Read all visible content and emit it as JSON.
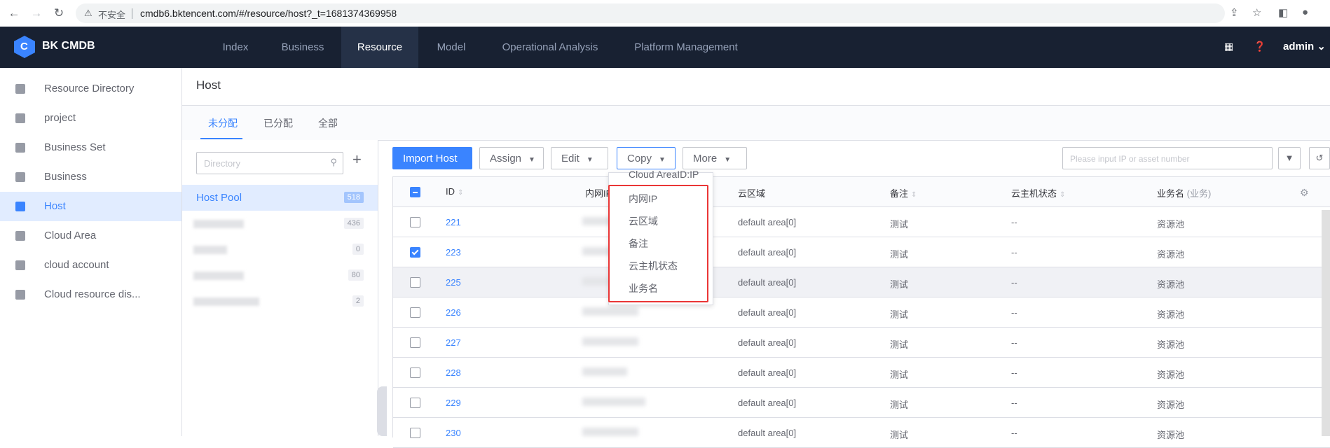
{
  "browser": {
    "insecure_label": "不安全",
    "url": "cmdb6.bktencent.com/#/resource/host?_t=1681374369958"
  },
  "app": {
    "logo_letter": "C",
    "name": "BK CMDB"
  },
  "topnav": {
    "items": [
      "Index",
      "Business",
      "Resource",
      "Model",
      "Operational Analysis",
      "Platform Management"
    ],
    "active": "Resource",
    "user": "admin"
  },
  "sidebar": {
    "items": [
      {
        "label": "Resource Directory"
      },
      {
        "label": "project"
      },
      {
        "label": "Business Set"
      },
      {
        "label": "Business"
      },
      {
        "label": "Host"
      },
      {
        "label": "Cloud Area"
      },
      {
        "label": "cloud account"
      },
      {
        "label": "Cloud resource dis..."
      }
    ],
    "active": "Host"
  },
  "page": {
    "title": "Host"
  },
  "tabs": [
    "未分配",
    "已分配",
    "全部"
  ],
  "directory": {
    "placeholder": "Directory",
    "rows": [
      {
        "name": "Host Pool",
        "count": "518"
      },
      {
        "name": "",
        "count": "436"
      },
      {
        "name": "",
        "count": "0"
      },
      {
        "name": "",
        "count": "80"
      },
      {
        "name": "",
        "count": "2"
      }
    ]
  },
  "toolbar": {
    "import": "Import Host",
    "assign": "Assign",
    "edit": "Edit",
    "copy": "Copy",
    "more": "More",
    "search_placeholder": "Please input IP or asset number"
  },
  "table": {
    "headers": {
      "id": "ID",
      "inner_ip": "内网IP",
      "cloud_area": "云区域",
      "remark": "备注",
      "cloud_status": "云主机状态",
      "biz_name": "业务名",
      "biz_name_sub": "(业务)"
    },
    "rows": [
      {
        "id": "221",
        "cloud_area": "default area[0]",
        "remark": "测试",
        "status": "--",
        "biz": "资源池",
        "checked": false
      },
      {
        "id": "223",
        "cloud_area": "default area[0]",
        "remark": "测试",
        "status": "--",
        "biz": "资源池",
        "checked": true
      },
      {
        "id": "225",
        "cloud_area": "default area[0]",
        "remark": "测试",
        "status": "--",
        "biz": "资源池",
        "checked": false
      },
      {
        "id": "226",
        "cloud_area": "default area[0]",
        "remark": "测试",
        "status": "--",
        "biz": "资源池",
        "checked": false
      },
      {
        "id": "227",
        "cloud_area": "default area[0]",
        "remark": "测试",
        "status": "--",
        "biz": "资源池",
        "checked": false
      },
      {
        "id": "228",
        "cloud_area": "default area[0]",
        "remark": "测试",
        "status": "--",
        "biz": "资源池",
        "checked": false
      },
      {
        "id": "229",
        "cloud_area": "default area[0]",
        "remark": "测试",
        "status": "--",
        "biz": "资源池",
        "checked": false
      },
      {
        "id": "230",
        "cloud_area": "default area[0]",
        "remark": "测试",
        "status": "--",
        "biz": "资源池",
        "checked": false
      }
    ]
  },
  "copy_menu": {
    "cut_item": "Cloud AreaID:IP",
    "items": [
      "内网IP",
      "云区域",
      "备注",
      "云主机状态",
      "业务名"
    ]
  }
}
